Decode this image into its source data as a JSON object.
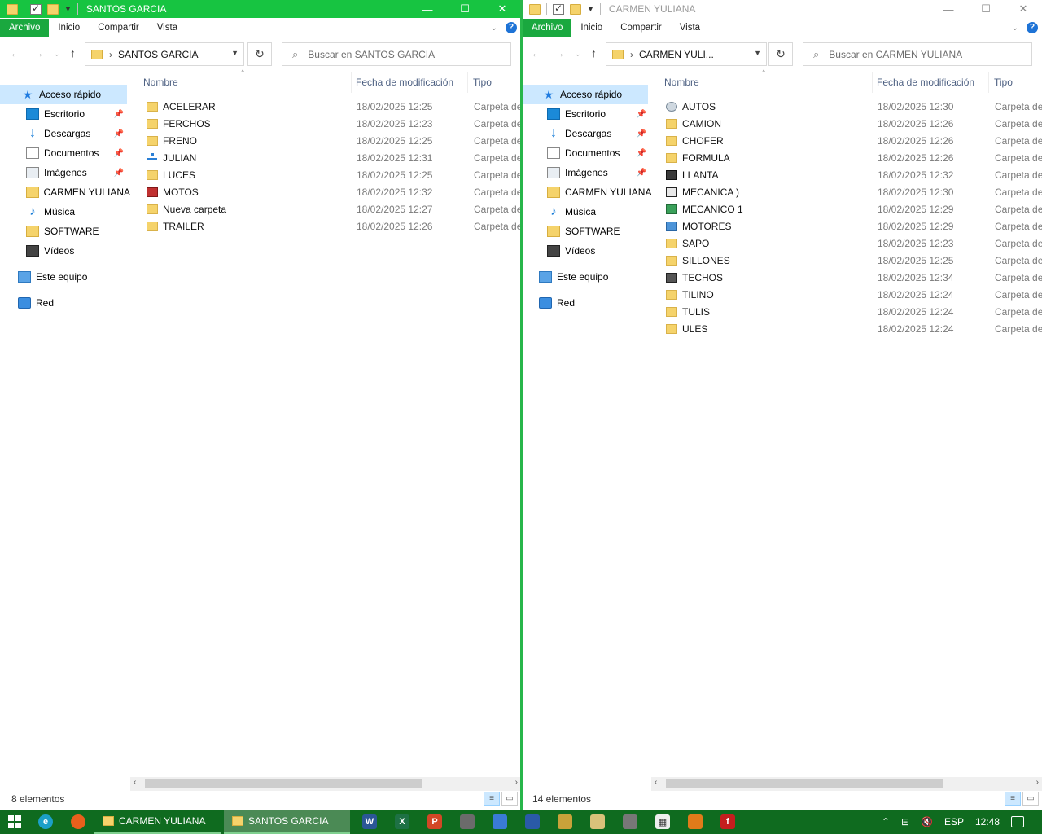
{
  "windows": {
    "left": {
      "title": "SANTOS  GARCIA",
      "ribbon_tabs": [
        "Archivo",
        "Inicio",
        "Compartir",
        "Vista"
      ],
      "address": "SANTOS  GARCIA",
      "search_placeholder": "Buscar en SANTOS  GARCIA",
      "columns": [
        "Nombre",
        "Fecha de modificación",
        "Tipo"
      ],
      "items": [
        {
          "name": "ACELERAR",
          "date": "18/02/2025 12:25",
          "type": "Carpeta de",
          "icon": "folder-icon"
        },
        {
          "name": "FERCHOS",
          "date": "18/02/2025 12:23",
          "type": "Carpeta de",
          "icon": "folder-icon"
        },
        {
          "name": "FRENO",
          "date": "18/02/2025 12:25",
          "type": "Carpeta de",
          "icon": "folder-icon"
        },
        {
          "name": "JULIAN",
          "date": "18/02/2025 12:31",
          "type": "Carpeta de",
          "icon": "network-folder-icon"
        },
        {
          "name": "LUCES",
          "date": "18/02/2025 12:25",
          "type": "Carpeta de",
          "icon": "folder-icon"
        },
        {
          "name": "MOTOS",
          "date": "18/02/2025 12:32",
          "type": "Carpeta de",
          "icon": "custom-folder-icon"
        },
        {
          "name": "Nueva carpeta",
          "date": "18/02/2025 12:27",
          "type": "Carpeta de",
          "icon": "folder-icon"
        },
        {
          "name": "TRAILER",
          "date": "18/02/2025 12:26",
          "type": "Carpeta de",
          "icon": "folder-icon"
        }
      ],
      "status": "8 elementos"
    },
    "right": {
      "title": "CARMEN YULIANA",
      "ribbon_tabs": [
        "Archivo",
        "Inicio",
        "Compartir",
        "Vista"
      ],
      "address": "CARMEN YULI...",
      "search_placeholder": "Buscar en CARMEN YULIANA",
      "columns": [
        "Nombre",
        "Fecha de modificación",
        "Tipo"
      ],
      "items": [
        {
          "name": "AUTOS",
          "date": "18/02/2025 12:30",
          "type": "Carpeta de",
          "icon": "disc-folder-icon"
        },
        {
          "name": "CAMION",
          "date": "18/02/2025 12:26",
          "type": "Carpeta de",
          "icon": "folder-icon"
        },
        {
          "name": "CHOFER",
          "date": "18/02/2025 12:26",
          "type": "Carpeta de",
          "icon": "folder-icon"
        },
        {
          "name": "FORMULA",
          "date": "18/02/2025 12:26",
          "type": "Carpeta de",
          "icon": "folder-icon"
        },
        {
          "name": "LLANTA",
          "date": "18/02/2025 12:32",
          "type": "Carpeta de",
          "icon": "drive-folder-icon"
        },
        {
          "name": "MECANICA )",
          "date": "18/02/2025 12:30",
          "type": "Carpeta de",
          "icon": "checklist-folder-icon"
        },
        {
          "name": "MECANICO 1",
          "date": "18/02/2025 12:29",
          "type": "Carpeta de",
          "icon": "tools-folder-icon"
        },
        {
          "name": "MOTORES",
          "date": "18/02/2025 12:29",
          "type": "Carpeta de",
          "icon": "monitor-folder-icon"
        },
        {
          "name": "SAPO",
          "date": "18/02/2025 12:23",
          "type": "Carpeta de",
          "icon": "folder-icon"
        },
        {
          "name": "SILLONES",
          "date": "18/02/2025 12:25",
          "type": "Carpeta de",
          "icon": "folder-icon"
        },
        {
          "name": "TECHOS",
          "date": "18/02/2025 12:34",
          "type": "Carpeta de",
          "icon": "film-folder-icon"
        },
        {
          "name": "TILINO",
          "date": "18/02/2025 12:24",
          "type": "Carpeta de",
          "icon": "folder-icon"
        },
        {
          "name": "TULIS",
          "date": "18/02/2025 12:24",
          "type": "Carpeta de",
          "icon": "folder-icon"
        },
        {
          "name": "ULES",
          "date": "18/02/2025 12:24",
          "type": "Carpeta de",
          "icon": "folder-icon"
        }
      ],
      "status": "14 elementos"
    }
  },
  "sidebar": {
    "quick_access": "Acceso rápido",
    "items": [
      {
        "label": "Escritorio",
        "icon": "desktop-icon",
        "pinned": true
      },
      {
        "label": "Descargas",
        "icon": "downloads-icon",
        "pinned": true
      },
      {
        "label": "Documentos",
        "icon": "documents-icon",
        "pinned": true
      },
      {
        "label": "Imágenes",
        "icon": "pictures-icon",
        "pinned": true
      },
      {
        "label": "CARMEN YULIANA",
        "icon": "folder-icon",
        "pinned": false
      },
      {
        "label": "Música",
        "icon": "music-icon",
        "pinned": false
      },
      {
        "label": "SOFTWARE",
        "icon": "folder-icon",
        "pinned": false
      },
      {
        "label": "Vídeos",
        "icon": "videos-icon",
        "pinned": false
      }
    ],
    "this_pc": "Este equipo",
    "network": "Red"
  },
  "taskbar": {
    "windows": [
      "CARMEN YULIANA",
      "SANTOS  GARCIA"
    ],
    "active_window": "SANTOS  GARCIA",
    "language": "ESP",
    "time": "12:48"
  },
  "colors": {
    "active_title": "#17c441",
    "taskbar": "#0f6b1f",
    "file_tab": "#1aa83f"
  }
}
